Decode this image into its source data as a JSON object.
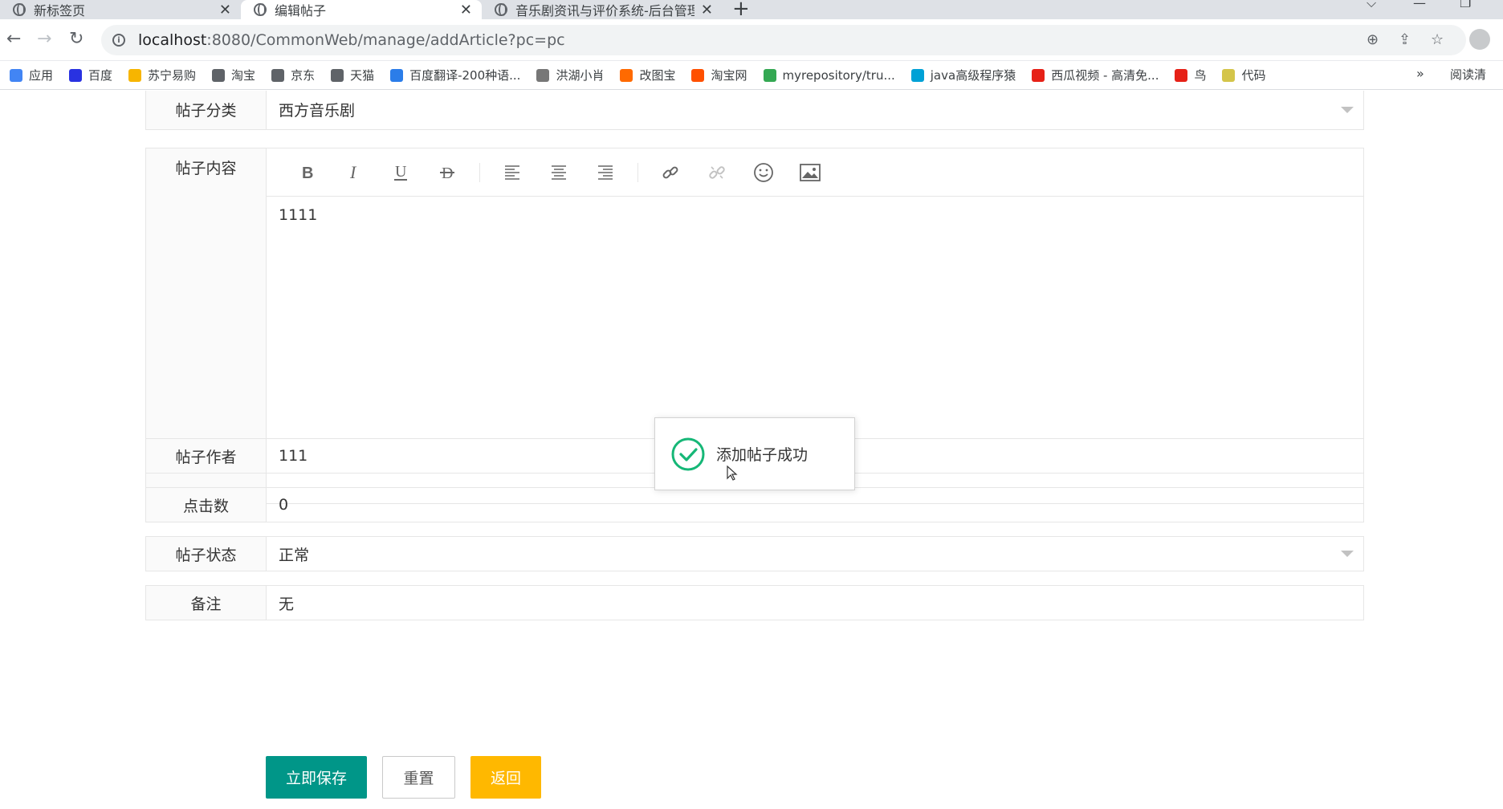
{
  "browser": {
    "tabs": [
      {
        "title": "新标签页",
        "active": false
      },
      {
        "title": "编辑帖子",
        "active": true
      },
      {
        "title": "音乐剧资讯与评价系统-后台管理",
        "active": false
      }
    ],
    "url_host": "localhost",
    "url_rest": ":8080/CommonWeb/manage/addArticle?pc=pc",
    "bookmarks": [
      {
        "label": "应用",
        "color": "#4285f4"
      },
      {
        "label": "百度",
        "color": "#2932e1"
      },
      {
        "label": "苏宁易购",
        "color": "#f7b500"
      },
      {
        "label": "淘宝",
        "color": "#5f6368"
      },
      {
        "label": "京东",
        "color": "#5f6368"
      },
      {
        "label": "天猫",
        "color": "#5f6368"
      },
      {
        "label": "百度翻译-200种语...",
        "color": "#2b7de9"
      },
      {
        "label": "洪湖小肖",
        "color": "#777777"
      },
      {
        "label": "改图宝",
        "color": "#ff6a00"
      },
      {
        "label": "淘宝网",
        "color": "#ff5000"
      },
      {
        "label": "myrepository/tru...",
        "color": "#34a853"
      },
      {
        "label": "java高级程序猿",
        "color": "#00a1d6"
      },
      {
        "label": "西瓜视频 - 高清免...",
        "color": "#e62117"
      },
      {
        "label": "鸟",
        "color": "#e62117"
      },
      {
        "label": "代码",
        "color": "#d4c54a"
      }
    ],
    "bookmarks_more": "»",
    "reading_list": "阅读清"
  },
  "form": {
    "category": {
      "label": "帖子分类",
      "value": "西方音乐剧"
    },
    "content": {
      "label": "帖子内容",
      "value": "1111"
    },
    "author": {
      "label": "帖子作者",
      "value": "111"
    },
    "clicks": {
      "label": "点击数",
      "value": "0"
    },
    "status": {
      "label": "帖子状态",
      "value": "正常"
    },
    "remark": {
      "label": "备注",
      "value": "无"
    }
  },
  "editor_toolbar": [
    "bold-icon",
    "italic-icon",
    "underline-icon",
    "strikethrough-icon",
    "align-left-icon",
    "align-center-icon",
    "align-right-icon",
    "link-icon",
    "unlink-icon",
    "emoji-icon",
    "image-icon"
  ],
  "toast": {
    "message": "添加帖子成功"
  },
  "buttons": {
    "save": "立即保存",
    "reset": "重置",
    "back": "返回"
  },
  "colors": {
    "primary": "#009688",
    "warm": "#ffb800",
    "success_icon": "#16b777"
  }
}
